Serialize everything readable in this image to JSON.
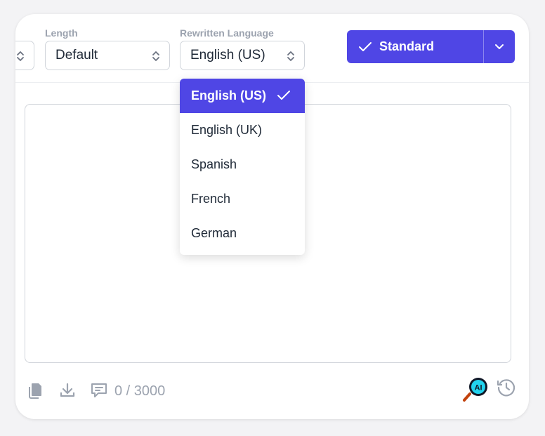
{
  "controls": {
    "length_label": "Length",
    "length_value": "Default",
    "language_label": "Rewritten Language",
    "language_value": "English (US)"
  },
  "mode_button": {
    "label": "Standard",
    "icon": "check-icon"
  },
  "language_dropdown": {
    "options": [
      "English (US)",
      "English (UK)",
      "Spanish",
      "French",
      "German"
    ],
    "selected": "English (US)"
  },
  "footer": {
    "char_count": "0 / 3000",
    "icons": [
      "copy-icon",
      "download-icon",
      "feedback-icon",
      "ai-detector-icon",
      "history-icon"
    ]
  },
  "colors": {
    "accent": "#4f46e5",
    "muted_text": "#9ca3af",
    "border": "#d1d5db"
  }
}
